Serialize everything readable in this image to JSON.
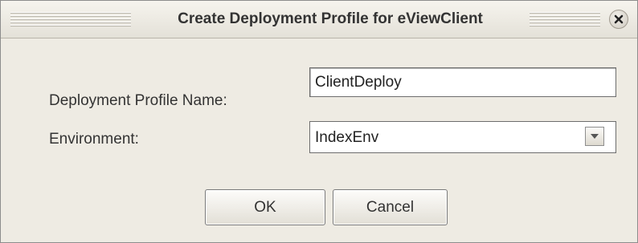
{
  "dialog": {
    "title": "Create Deployment Profile for eViewClient",
    "close_icon": "close-icon"
  },
  "form": {
    "profile_name": {
      "label": "Deployment Profile Name:",
      "value": "ClientDeploy"
    },
    "environment": {
      "label": "Environment:",
      "selected": "IndexEnv",
      "dropdown_icon": "chevron-down-icon"
    }
  },
  "buttons": {
    "ok_label": "OK",
    "cancel_label": "Cancel"
  }
}
